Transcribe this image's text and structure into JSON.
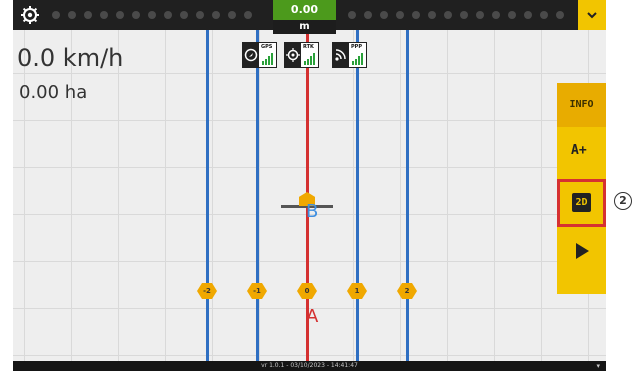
{
  "status_top": {
    "device_value": "0.00",
    "device_unit": "m",
    "menu_icon": "chevron-down-icon",
    "settings_icon": "gear-icon"
  },
  "readouts": {
    "speed": "0.0 km/h",
    "area": "0.00 ha"
  },
  "signal_indicators": [
    {
      "label": "GPS",
      "icon": "compass-icon"
    },
    {
      "label": "RTK",
      "icon": "crosshair-icon"
    },
    {
      "label": "PPP",
      "icon": "wifi-icon"
    }
  ],
  "guidance": {
    "point_a": "A",
    "point_b": "B",
    "line_tags": [
      "-2",
      "-1",
      "0",
      "1",
      "2"
    ],
    "colors": {
      "reference_line": "#d43030",
      "parallel_line": "#2f6fc2",
      "tag": "#f0a800"
    }
  },
  "right_panel": {
    "info_label": "INFO",
    "aplus_label": "A+",
    "view_2d_label": "2D",
    "play_icon": "play-icon"
  },
  "footer": {
    "version": "vr 1.0.1 - 03/10/2023 - 14:41:47"
  },
  "callout": "2"
}
